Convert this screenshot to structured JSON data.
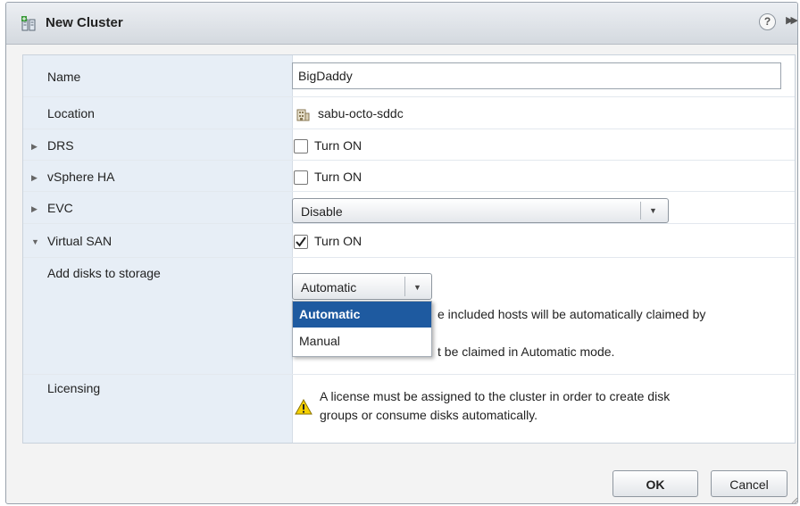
{
  "dialog": {
    "title": "New Cluster",
    "help_glyph": "?",
    "expand_glyph": "▶▶"
  },
  "form": {
    "name": {
      "label": "Name",
      "value": "BigDaddy"
    },
    "location": {
      "label": "Location",
      "value": "sabu-octo-sddc"
    },
    "drs": {
      "label": "DRS",
      "toggle_label": "Turn ON",
      "checked": false
    },
    "vsphere_ha": {
      "label": "vSphere HA",
      "toggle_label": "Turn ON",
      "checked": false
    },
    "evc": {
      "label": "EVC",
      "selected": "Disable"
    },
    "virtual_san": {
      "label": "Virtual SAN",
      "toggle_label": "Turn ON",
      "checked": true
    },
    "add_disks": {
      "label": "Add disks to storage",
      "selected": "Automatic",
      "desc_line1_visible": "e included hosts will be automatically claimed by",
      "desc_line2_visible": "t be claimed in Automatic mode.",
      "options": [
        "Automatic",
        "Manual"
      ]
    },
    "licensing": {
      "label": "Licensing",
      "warning_line1": "A license must be assigned to the cluster in order to create disk",
      "warning_line2": "groups or consume disks automatically."
    }
  },
  "footer": {
    "ok_label": "OK",
    "cancel_label": "Cancel"
  },
  "colors": {
    "selected_option_bg": "#1e5aa0",
    "label_column_bg": "#e7eef6",
    "warning_yellow": "#f5d000"
  }
}
